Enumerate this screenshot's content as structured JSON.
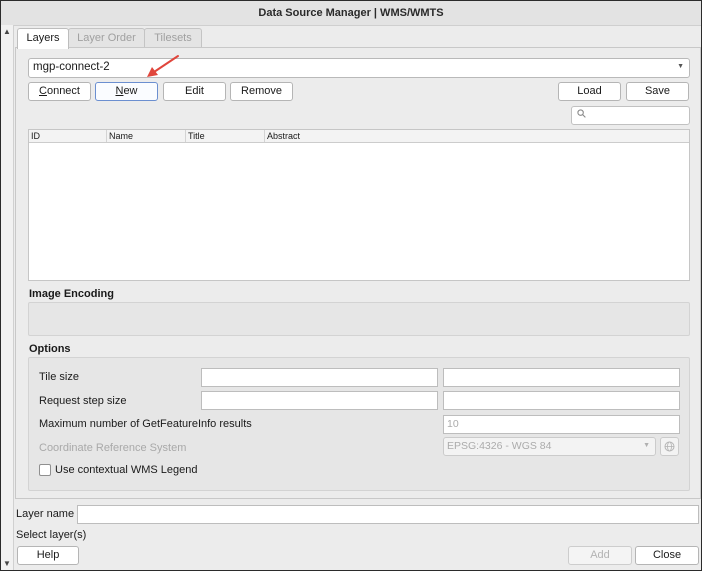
{
  "window": {
    "title": "Data Source Manager | WMS/WMTS"
  },
  "tabs": [
    {
      "label": "Layers",
      "active": true
    },
    {
      "label": "Layer Order",
      "active": false
    },
    {
      "label": "Tilesets",
      "active": false
    }
  ],
  "connection": {
    "selected": "mgp-connect-2",
    "buttons": {
      "connect": "Connect",
      "new": "New",
      "edit": "Edit",
      "remove": "Remove",
      "load": "Load",
      "save": "Save"
    }
  },
  "layers_table": {
    "columns": [
      "ID",
      "Name",
      "Title",
      "Abstract"
    ],
    "rows": []
  },
  "image_encoding": {
    "heading": "Image Encoding"
  },
  "options": {
    "heading": "Options",
    "tile_size_label": "Tile size",
    "request_step_label": "Request step size",
    "max_gfi_label": "Maximum number of GetFeatureInfo results",
    "max_gfi_value": "10",
    "crs_label": "Coordinate Reference System",
    "crs_value": "EPSG:4326 - WGS 84",
    "legend_label": "Use contextual WMS Legend",
    "legend_checked": false
  },
  "layer_name_label": "Layer name",
  "select_layers_label": "Select layer(s)",
  "footer": {
    "help": "Help",
    "add": "Add",
    "close": "Close"
  },
  "colors": {
    "arrow": "#e0463c",
    "default_button_border": "#6b8fd0"
  },
  "icons": {
    "search": "search-icon",
    "crs": "globe-icon",
    "dropdown": "chevron-down-icon"
  }
}
